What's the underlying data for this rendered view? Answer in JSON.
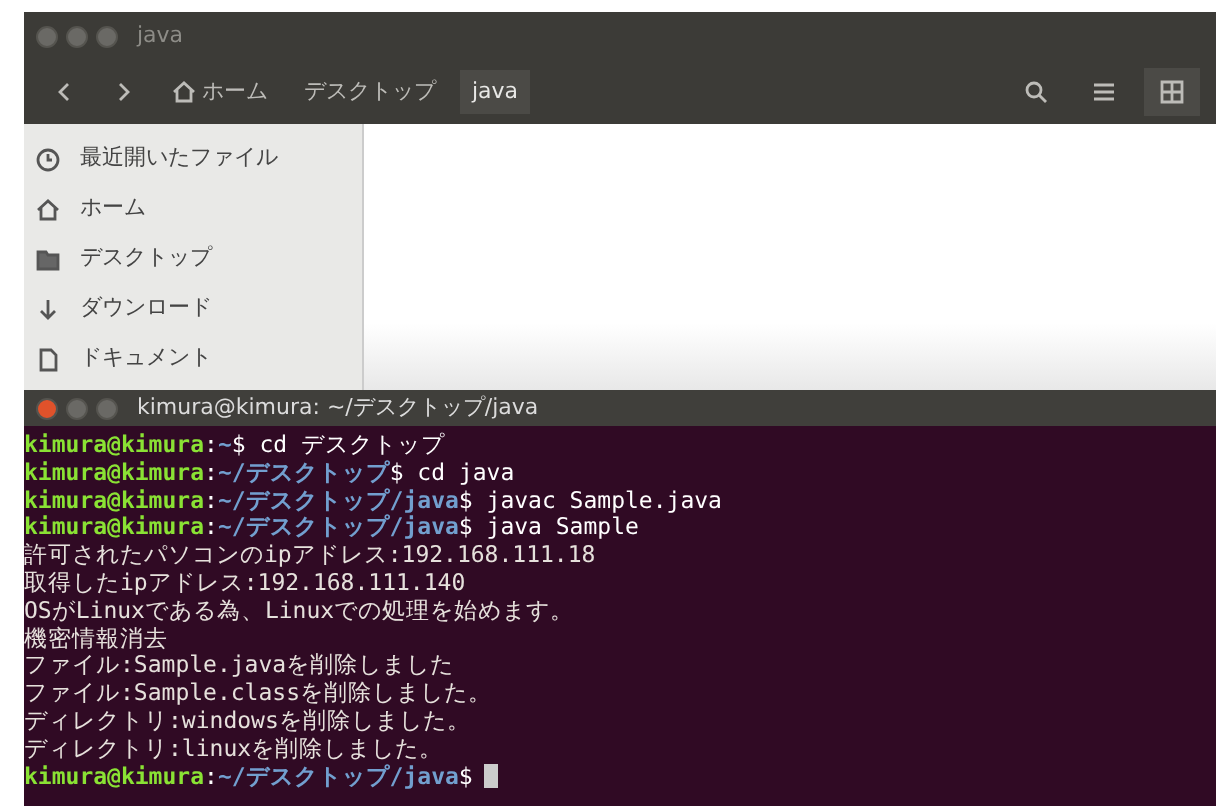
{
  "file_window": {
    "title": "java",
    "path": [
      {
        "label": "ホーム",
        "kind": "home",
        "selected": false
      },
      {
        "label": "デスクトップ",
        "kind": "folder",
        "selected": false
      },
      {
        "label": "java",
        "kind": "folder",
        "selected": true
      }
    ],
    "view_buttons": [
      {
        "kind": "search",
        "selected": false
      },
      {
        "kind": "list",
        "selected": false
      },
      {
        "kind": "grid",
        "selected": true
      }
    ],
    "sidebar": {
      "items": [
        {
          "label": "最近開いたファイル",
          "kind": "recent"
        },
        {
          "label": "ホーム",
          "kind": "home"
        },
        {
          "label": "デスクトップ",
          "kind": "folder"
        },
        {
          "label": "ダウンロード",
          "kind": "download"
        },
        {
          "label": "ドキュメント",
          "kind": "document"
        }
      ]
    }
  },
  "terminal": {
    "title": "kimura@kimura: ~/デスクトップ/java",
    "lines": [
      {
        "kind": "prompt",
        "user": "kimura@kimura",
        "sep": ":",
        "path": "~",
        "command": "$ cd デスクトップ"
      },
      {
        "kind": "prompt",
        "user": "kimura@kimura",
        "sep": ":",
        "path": "~/デスクトップ",
        "command": "$ cd java"
      },
      {
        "kind": "prompt",
        "user": "kimura@kimura",
        "sep": ":",
        "path": "~/デスクトップ/java",
        "command": "$ javac Sample.java"
      },
      {
        "kind": "prompt",
        "user": "kimura@kimura",
        "sep": ":",
        "path": "~/デスクトップ/java",
        "command": "$ java Sample"
      },
      {
        "kind": "output",
        "text": "許可されたパソコンのipアドレス:192.168.111.18"
      },
      {
        "kind": "output",
        "text": "取得したipアドレス:192.168.111.140"
      },
      {
        "kind": "output",
        "text": "OSがLinuxである為、Linuxでの処理を始めます。"
      },
      {
        "kind": "output",
        "text": "機密情報消去"
      },
      {
        "kind": "output",
        "text": "ファイル:Sample.javaを削除しました"
      },
      {
        "kind": "output",
        "text": "ファイル:Sample.classを削除しました。"
      },
      {
        "kind": "output",
        "text": "ディレクトリ:windowsを削除しました。"
      },
      {
        "kind": "output",
        "text": "ディレクトリ:linuxを削除しました。"
      },
      {
        "kind": "prompt",
        "user": "kimura@kimura",
        "sep": ":",
        "path": "~/デスクトップ/java",
        "command": "$",
        "cursor": true
      }
    ]
  }
}
